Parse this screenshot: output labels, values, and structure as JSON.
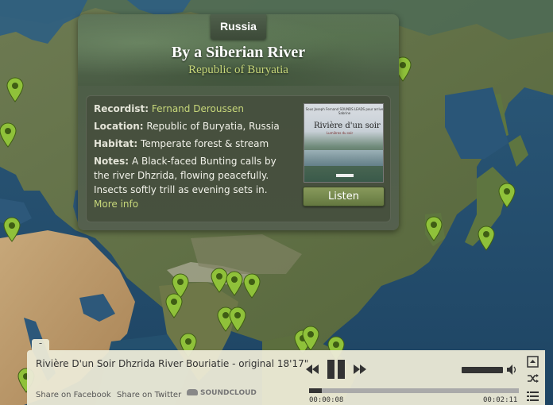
{
  "popup": {
    "country": "Russia",
    "title": "By a Siberian River",
    "region": "Republic of Buryatia",
    "recordist_label": "Recordist:",
    "recordist_value": "Fernand Deroussen",
    "location_label": "Location:",
    "location_value": "Republic of Buryatia, Russia",
    "habitat_label": "Habitat:",
    "habitat_value": "Temperate forest & stream",
    "notes_label": "Notes:",
    "notes_value": "A Black-faced Bunting calls by the river Dhzrida, flowing peacefully. Insects softly trill as evening sets in.",
    "more_info": "More info",
    "album_top_text": "Sous Joseph Fernand SOUNDS LEADS pour arrive Sabrine",
    "album_title": "Rivière d'un soir",
    "album_subtitle": "Lumières du soir",
    "listen_label": "Listen"
  },
  "player": {
    "collapse_label": "-",
    "track_title": "Rivière D'un Soir Dhzrida River Bouriatie - original 18'17\"",
    "share_facebook": "Share on Facebook",
    "share_twitter": "Share on Twitter",
    "soundcloud_label": "SOUNDCLOUD",
    "time_current": "00:00:08",
    "time_duration": "00:02:11",
    "progress_fraction": 0.06,
    "volume_fraction": 0.85
  },
  "icons": {
    "prev": "prev-track-icon",
    "pause": "pause-icon",
    "next": "next-track-icon",
    "volume": "volume-icon",
    "expand": "expand-icon",
    "shuffle": "shuffle-icon",
    "playlist": "playlist-icon",
    "pin": "map-pin-icon"
  },
  "colors": {
    "pin": "#8fc13a",
    "accent": "#c7d77a",
    "ocean": "#24506e",
    "land": "#5b6e3f"
  }
}
